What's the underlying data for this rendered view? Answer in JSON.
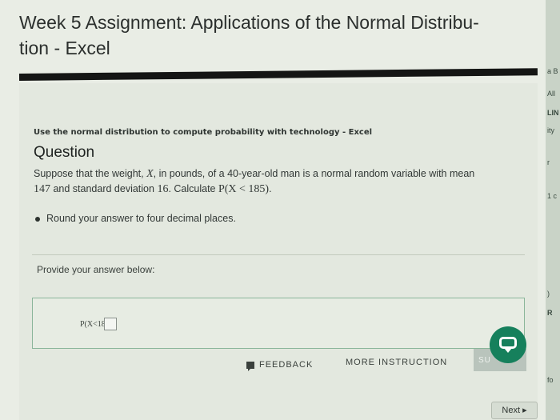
{
  "title": {
    "line1": "Week 5 Assignment: Applications of the Normal Distribu-",
    "line2": "tion - Excel"
  },
  "question": {
    "topic": "Use the normal distribution to compute probability with technology - Excel",
    "heading": "Question",
    "text_part1": "Suppose that the weight, ",
    "var_x": "X",
    "text_part2": ", in pounds, of a 40-year-old man is a normal random variable with mean",
    "text_line2_mean": "147",
    "text_part3": " and standard deviation ",
    "text_sd": "16",
    "text_part4": ". Calculate ",
    "text_prob": "P(X < 185)",
    "text_end": ".",
    "bullet": "Round your answer to four decimal places."
  },
  "answer": {
    "prompt": "Provide your answer below:",
    "label": "P(X<185)=",
    "value": ""
  },
  "footer": {
    "feedback_label": "FEEDBACK",
    "more_instruction_label": "MORE INSTRUCTION",
    "submit_label": "SU",
    "next_label": "Next ▸"
  },
  "side_strip": {
    "items": [
      "a B",
      "All",
      "LIN",
      "ity",
      "r",
      "1 c",
      ")",
      "R",
      "fo"
    ]
  },
  "colors": {
    "chat_button": "#16805c",
    "page_bg": "#e9ede5"
  }
}
